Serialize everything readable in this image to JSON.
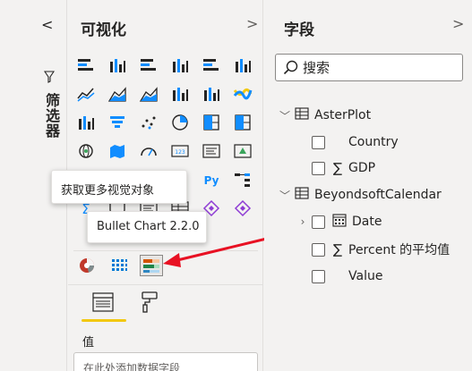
{
  "filters": {
    "label": "筛选器",
    "collapse_glyph": "<"
  },
  "visualizations": {
    "title": "可视化",
    "chevron": ">",
    "grid_icons": [
      "stacked-bar-icon",
      "stacked-column-icon",
      "clustered-bar-icon",
      "clustered-column-icon",
      "100-stacked-bar-icon",
      "100-stacked-column-icon",
      "line-chart-icon",
      "area-chart-icon",
      "stacked-area-icon",
      "line-column-icon",
      "line-stacked-column-icon",
      "ribbon-chart-icon",
      "waterfall-icon",
      "funnel-icon",
      "scatter-icon",
      "pie-icon",
      "treemap-icon",
      "map-icon",
      "globe-icon",
      "filled-map-icon",
      "gauge-icon",
      "card-icon",
      "multi-row-card-icon",
      "kpi-icon",
      "slicer-icon",
      "table-icon",
      "matrix-icon",
      "r-visual-icon",
      "python-visual-icon",
      "key-influencers-icon",
      "decomposition-tree-icon",
      "qna-icon",
      "narrative-icon",
      "paginated-icon",
      "power-apps-icon",
      "power-automate-icon"
    ],
    "custom_visuals": [
      "aster-plot-icon",
      "calendar-visual-icon",
      "bullet-chart-icon"
    ],
    "values_label": "值",
    "values_placeholder": "在此处添加数据字段"
  },
  "tooltips": {
    "get_more": "获取更多视觉对象",
    "bullet": "Bullet Chart 2.2.0"
  },
  "fields": {
    "title": "字段",
    "chevron": ">",
    "search_placeholder": "搜索",
    "tables": [
      {
        "name": "AsterPlot",
        "fields": [
          {
            "name": "Country",
            "kind": "text"
          },
          {
            "name": "GDP",
            "kind": "sum"
          }
        ]
      },
      {
        "name": "BeyondsoftCalendar",
        "fields": [
          {
            "name": "Date",
            "kind": "date"
          },
          {
            "name": "Percent 的平均值",
            "kind": "sum"
          },
          {
            "name": "Value",
            "kind": "text"
          }
        ]
      }
    ]
  },
  "colors": {
    "accent": "#f2c811",
    "arrow": "#e81123"
  }
}
